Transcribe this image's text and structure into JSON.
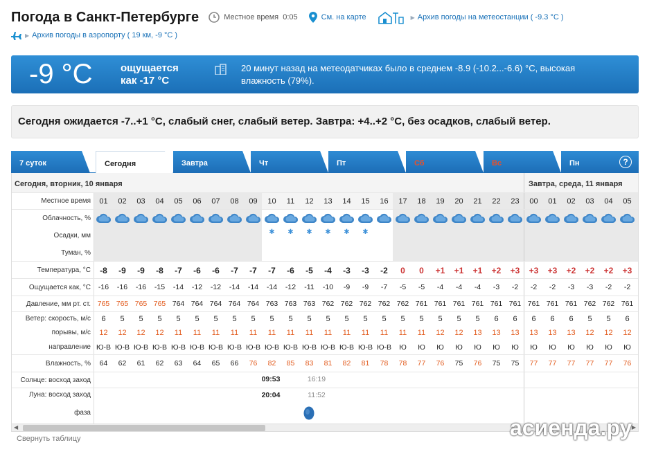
{
  "header": {
    "title": "Погода в Санкт-Петербурге",
    "local_time_label": "Местное время",
    "local_time": "0:05",
    "map_link": "См. на карте",
    "station_archive": "Архив погоды на метеостанции ( -9.3 °C )",
    "airport_archive": "Архив погоды в аэропорту ( 19 км, -9 °C )"
  },
  "now": {
    "temp": "-9 °C",
    "feels_label": "ощущается",
    "feels_value": "как -17 °C",
    "message": "20 минут назад на метеодатчиках было в среднем -8.9 (-10.2...-6.6) °C, высокая влажность (79%)."
  },
  "forecast_text": "Сегодня ожидается -7..+1 °C, слабый снег, слабый ветер. Завтра: +4..+2 °C, без осадков, слабый ветер.",
  "tabs": [
    "7 суток",
    "Сегодня",
    "Завтра",
    "Чт",
    "Пт",
    "Сб",
    "Вс",
    "Пн"
  ],
  "help": "?",
  "dates": {
    "today": "Сегодня, вторник, 10 января",
    "tomorrow": "Завтра, среда, 11 января"
  },
  "labels": {
    "time": "Местное время",
    "clouds": "Облачность, %",
    "precip": "Осадки, мм",
    "fog": "Туман, %",
    "temp": "Температура, °C",
    "feels": "Ощущается как, °C",
    "pressure": "Давление, мм рт. ст.",
    "wind": "Ветер: скорость, м/с",
    "gusts": "порывы, м/с",
    "dir": "направление",
    "hum": "Влажность, %",
    "sun": "Солнце: восход заход",
    "moon": "Луна: восход заход",
    "phase": "фаза"
  },
  "hours": [
    "01",
    "02",
    "03",
    "04",
    "05",
    "06",
    "07",
    "08",
    "09",
    "10",
    "11",
    "12",
    "13",
    "14",
    "15",
    "16",
    "17",
    "18",
    "19",
    "20",
    "21",
    "22",
    "23",
    "00",
    "01",
    "02",
    "03",
    "04",
    "05"
  ],
  "temp": [
    "-8",
    "-9",
    "-9",
    "-8",
    "-7",
    "-6",
    "-6",
    "-7",
    "-7",
    "-7",
    "-6",
    "-5",
    "-4",
    "-3",
    "-3",
    "-2",
    "0",
    "0",
    "+1",
    "+1",
    "+1",
    "+2",
    "+3",
    "+3",
    "+3",
    "+2",
    "+2",
    "+2",
    "+3"
  ],
  "feels": [
    "-16",
    "-16",
    "-16",
    "-15",
    "-14",
    "-12",
    "-12",
    "-14",
    "-14",
    "-14",
    "-12",
    "-11",
    "-10",
    "-9",
    "-9",
    "-7",
    "-5",
    "-5",
    "-4",
    "-4",
    "-4",
    "-3",
    "-2",
    "-2",
    "-2",
    "-3",
    "-3",
    "-2",
    "-2"
  ],
  "pressure": [
    "765",
    "765",
    "765",
    "765",
    "764",
    "764",
    "764",
    "764",
    "764",
    "763",
    "763",
    "763",
    "762",
    "762",
    "762",
    "762",
    "762",
    "761",
    "761",
    "761",
    "761",
    "761",
    "761",
    "761",
    "761",
    "761",
    "762",
    "762",
    "761"
  ],
  "wind": [
    "6",
    "5",
    "5",
    "5",
    "5",
    "5",
    "5",
    "5",
    "5",
    "5",
    "5",
    "5",
    "5",
    "5",
    "5",
    "5",
    "5",
    "5",
    "5",
    "5",
    "5",
    "6",
    "6",
    "6",
    "6",
    "6",
    "5",
    "5",
    "6"
  ],
  "gusts": [
    "12",
    "12",
    "12",
    "12",
    "11",
    "11",
    "11",
    "11",
    "11",
    "11",
    "11",
    "11",
    "11",
    "11",
    "11",
    "11",
    "11",
    "11",
    "12",
    "12",
    "13",
    "13",
    "13",
    "13",
    "13",
    "13",
    "12",
    "12",
    "12"
  ],
  "dir": [
    "Ю-В",
    "Ю-В",
    "Ю-В",
    "Ю-В",
    "Ю-В",
    "Ю-В",
    "Ю-В",
    "Ю-В",
    "Ю-В",
    "Ю-В",
    "Ю-В",
    "Ю-В",
    "Ю-В",
    "Ю-В",
    "Ю-В",
    "Ю-В",
    "Ю",
    "Ю",
    "Ю",
    "Ю",
    "Ю",
    "Ю",
    "Ю",
    "Ю",
    "Ю",
    "Ю",
    "Ю",
    "Ю",
    "Ю"
  ],
  "hum": [
    "64",
    "62",
    "61",
    "62",
    "63",
    "64",
    "65",
    "66",
    "76",
    "82",
    "85",
    "83",
    "81",
    "82",
    "81",
    "78",
    "78",
    "77",
    "76",
    "75",
    "76",
    "75",
    "75",
    "77",
    "77",
    "77",
    "77",
    "77",
    "76"
  ],
  "sun": {
    "rise": "09:53",
    "set": "16:19"
  },
  "moon": {
    "rise": "20:04",
    "set": "11:52"
  },
  "collapse": "Свернуть таблицу",
  "watermark": "асиенда.ру"
}
